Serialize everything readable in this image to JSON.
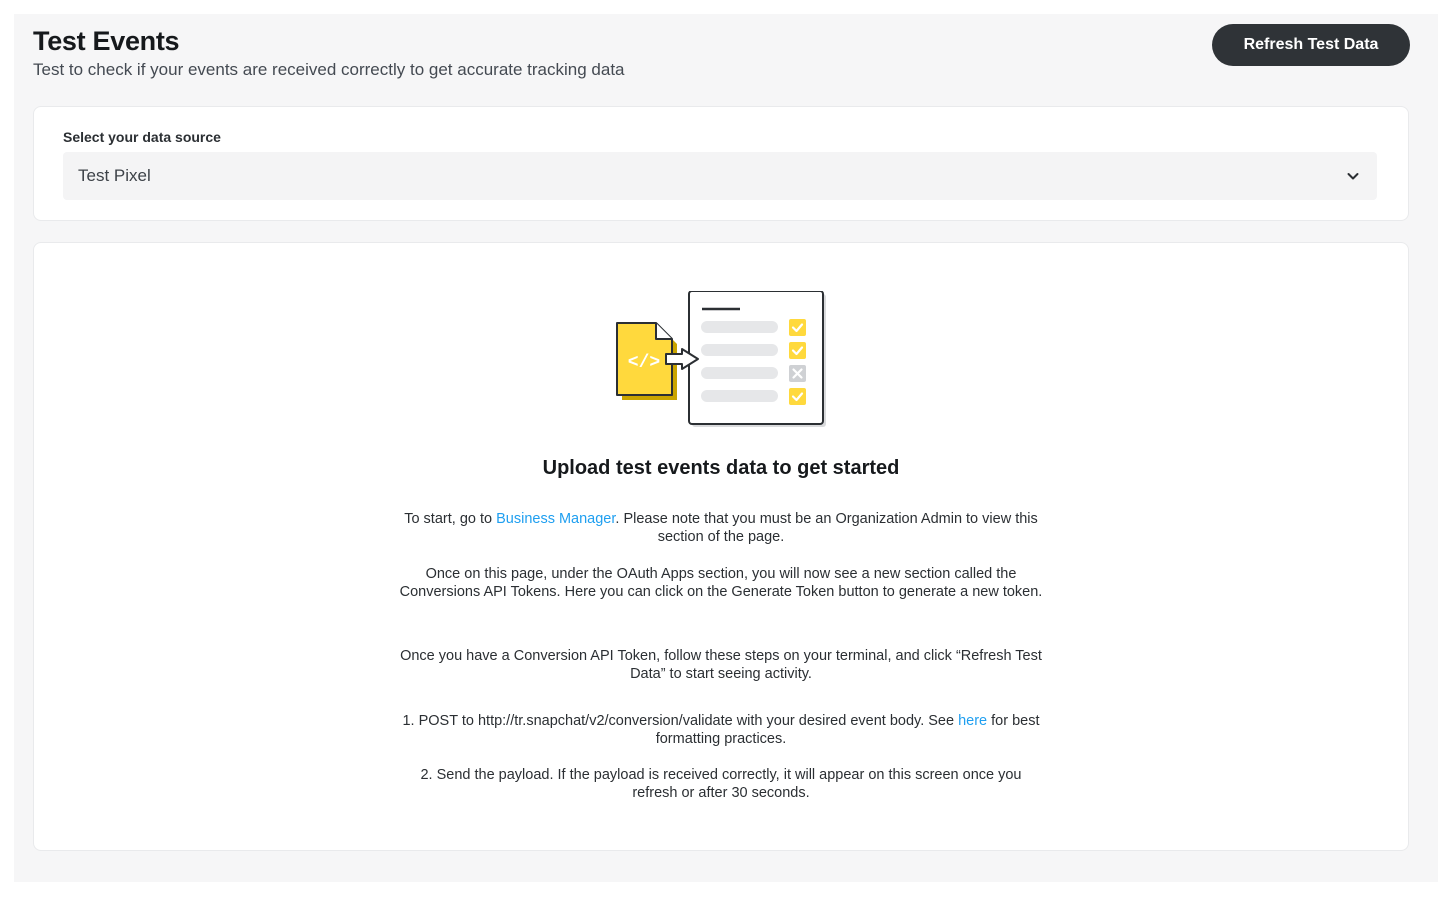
{
  "header": {
    "title": "Test Events",
    "subtitle": "Test to check if your events are received correctly to get accurate tracking data",
    "refresh_button": "Refresh Test Data"
  },
  "data_source": {
    "label": "Select your data source",
    "selected": "Test Pixel",
    "chevron_icon": "chevron-down-icon"
  },
  "empty_state": {
    "illustration": "code-file-checklist-illustration",
    "heading": "Upload test events data to get started",
    "p1_before": "To start, go to ",
    "p1_link": "Business Manager",
    "p1_after": ". Please note that you must be an Organization Admin to view this section of the page.",
    "p2": "Once on this page, under the OAuth Apps section, you will now see a new section called the Conversions API Tokens. Here you can click on the Generate Token button to generate a new token.",
    "p3": "Once you have a Conversion API Token, follow these steps on your terminal, and click “Refresh Test Data” to start seeing activity.",
    "step1_before": "1. POST to http://tr.snapchat/v2/conversion/validate with your desired event body. See ",
    "step1_link": "here",
    "step1_after": " for best formatting practices.",
    "step2": "2. Send the payload. If the payload is received correctly, it will appear on this screen once you refresh or after 30 seconds."
  },
  "colors": {
    "accent_yellow": "#FFD93D",
    "link_blue": "#1F9FF0",
    "button_dark": "#2F3337"
  }
}
